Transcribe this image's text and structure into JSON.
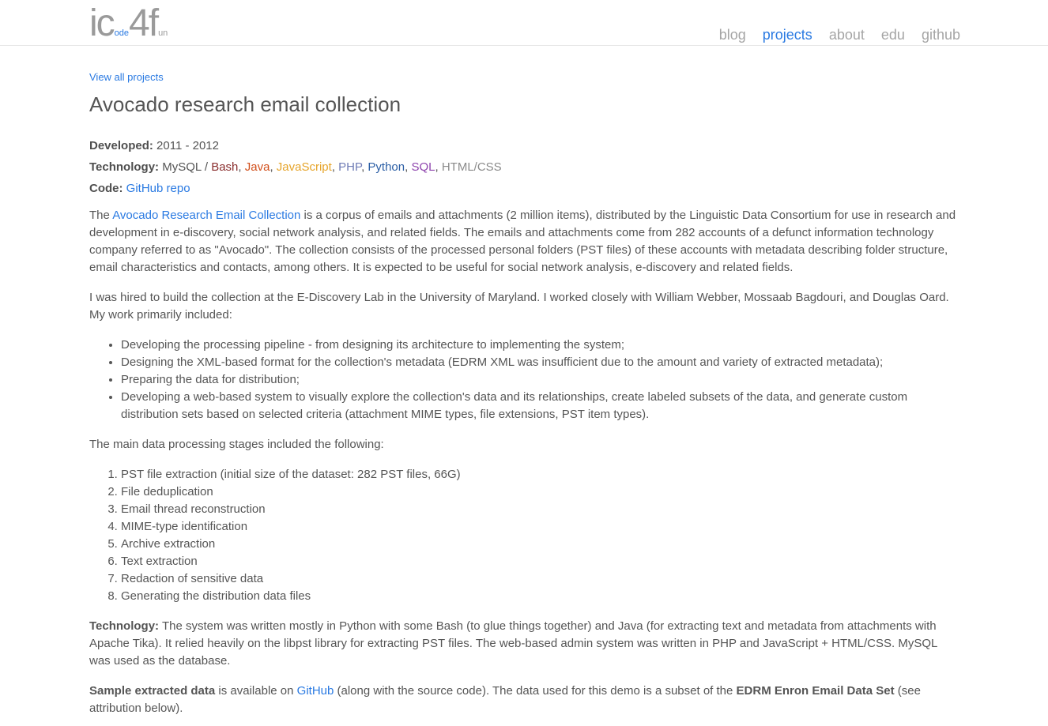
{
  "header": {
    "logo": {
      "part1": "ic",
      "part2": "ode",
      "part3": "4f",
      "part4": "un"
    },
    "nav": [
      {
        "label": "blog",
        "active": false
      },
      {
        "label": "projects",
        "active": true
      },
      {
        "label": "about",
        "active": false
      },
      {
        "label": "edu",
        "active": false
      },
      {
        "label": "github",
        "active": false
      }
    ]
  },
  "page": {
    "back_link": "View all projects",
    "title": "Avocado research email collection",
    "developed_label": "Developed:",
    "developed_value": "2011 - 2012",
    "technology_label": "Technology:",
    "tech_items": [
      {
        "name": "MySQL",
        "sep": " / ",
        "color": "#555555"
      },
      {
        "name": "Bash",
        "sep": ", ",
        "color": "#8a2e2e"
      },
      {
        "name": "Java",
        "sep": ", ",
        "color": "#d2501c"
      },
      {
        "name": "JavaScript",
        "sep": ", ",
        "color": "#e6a42a"
      },
      {
        "name": "PHP",
        "sep": ", ",
        "color": "#6f7cb6"
      },
      {
        "name": "Python",
        "sep": ", ",
        "color": "#2b5ea5"
      },
      {
        "name": "SQL",
        "sep": ", ",
        "color": "#8e44ad"
      },
      {
        "name": "HTML/CSS",
        "sep": "",
        "color": "#8a8a8a"
      }
    ],
    "code_label": "Code:",
    "code_link": "GitHub repo",
    "intro": {
      "pre": "The ",
      "link": "Avocado Research Email Collection",
      "post": " is a corpus of emails and attachments (2 million items), distributed by the Linguistic Data Consortium for use in research and development in e-discovery, social network analysis, and related fields. The emails and attachments come from 282 accounts of a defunct information technology company referred to as \"Avocado\". The collection consists of the processed personal folders (PST files) of these accounts with metadata describing folder structure, email characteristics and contacts, among others. It is expected to be useful for social network analysis, e-discovery and related fields."
    },
    "work_para": "I was hired to build the collection at the E-Discovery Lab in the University of Maryland. I worked closely with William Webber, Mossaab Bagdouri, and Douglas Oard. My work primarily included:",
    "work_items": [
      "Developing the processing pipeline - from designing its architecture to implementing the system;",
      "Designing the XML-based format for the collection's metadata (EDRM XML was insufficient due to the amount and variety of extracted metadata);",
      "Preparing the data for distribution;",
      "Developing a web-based system to visually explore the collection's data and its relationships, create labeled subsets of the data, and generate custom distribution sets based on selected criteria (attachment MIME types, file extensions, PST item types)."
    ],
    "stages_para": "The main data processing stages included the following:",
    "stages": [
      "PST file extraction (initial size of the dataset: 282 PST files, 66G)",
      "File deduplication",
      "Email thread reconstruction",
      "MIME-type identification",
      "Archive extraction",
      "Text extraction",
      "Redaction of sensitive data",
      "Generating the distribution data files"
    ],
    "tech_para_label": "Technology:",
    "tech_para_text": " The system was written mostly in Python with some Bash (to glue things together) and Java (for extracting text and metadata from attachments with Apache Tika). It relied heavily on the libpst library for extracting PST files. The web-based admin system was written in PHP and JavaScript + HTML/CSS. MySQL was used as the database.",
    "sample_label": "Sample extracted data",
    "sample_mid1": " is available on ",
    "sample_link": "GitHub",
    "sample_mid2": " (along with the source code). The data used for this demo is a subset of the ",
    "sample_bold": "EDRM Enron Email Data Set",
    "sample_end": " (see attribution below)."
  }
}
